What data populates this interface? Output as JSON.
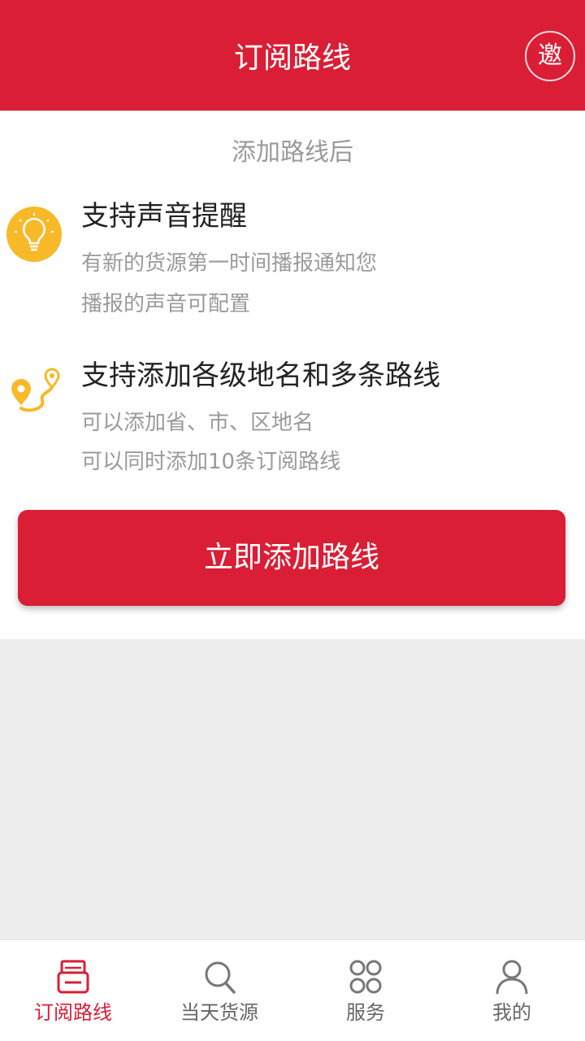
{
  "header": {
    "title": "订阅路线",
    "invite_label": "邀"
  },
  "content": {
    "intro": "添加路线后",
    "features": [
      {
        "icon": "lightbulb-icon",
        "title": "支持声音提醒",
        "lines": [
          "有新的货源第一时间播报通知您",
          "播报的声音可配置"
        ]
      },
      {
        "icon": "route-pin-icon",
        "title": "支持添加各级地名和多条路线",
        "lines": [
          "可以添加省、市、区地名",
          "可以同时添加10条订阅路线"
        ]
      }
    ],
    "add_button_label": "立即添加路线"
  },
  "bottom_nav": {
    "items": [
      {
        "label": "订阅路线",
        "icon": "subscribe-route-icon",
        "active": true
      },
      {
        "label": "当天货源",
        "icon": "search-icon",
        "active": false
      },
      {
        "label": "服务",
        "icon": "services-grid-icon",
        "active": false
      },
      {
        "label": "我的",
        "icon": "profile-icon",
        "active": false
      }
    ]
  },
  "colors": {
    "brand": "#da1e35",
    "accent_yellow": "#f7b928",
    "muted_text": "#9a9a9a",
    "background": "#ededed"
  }
}
